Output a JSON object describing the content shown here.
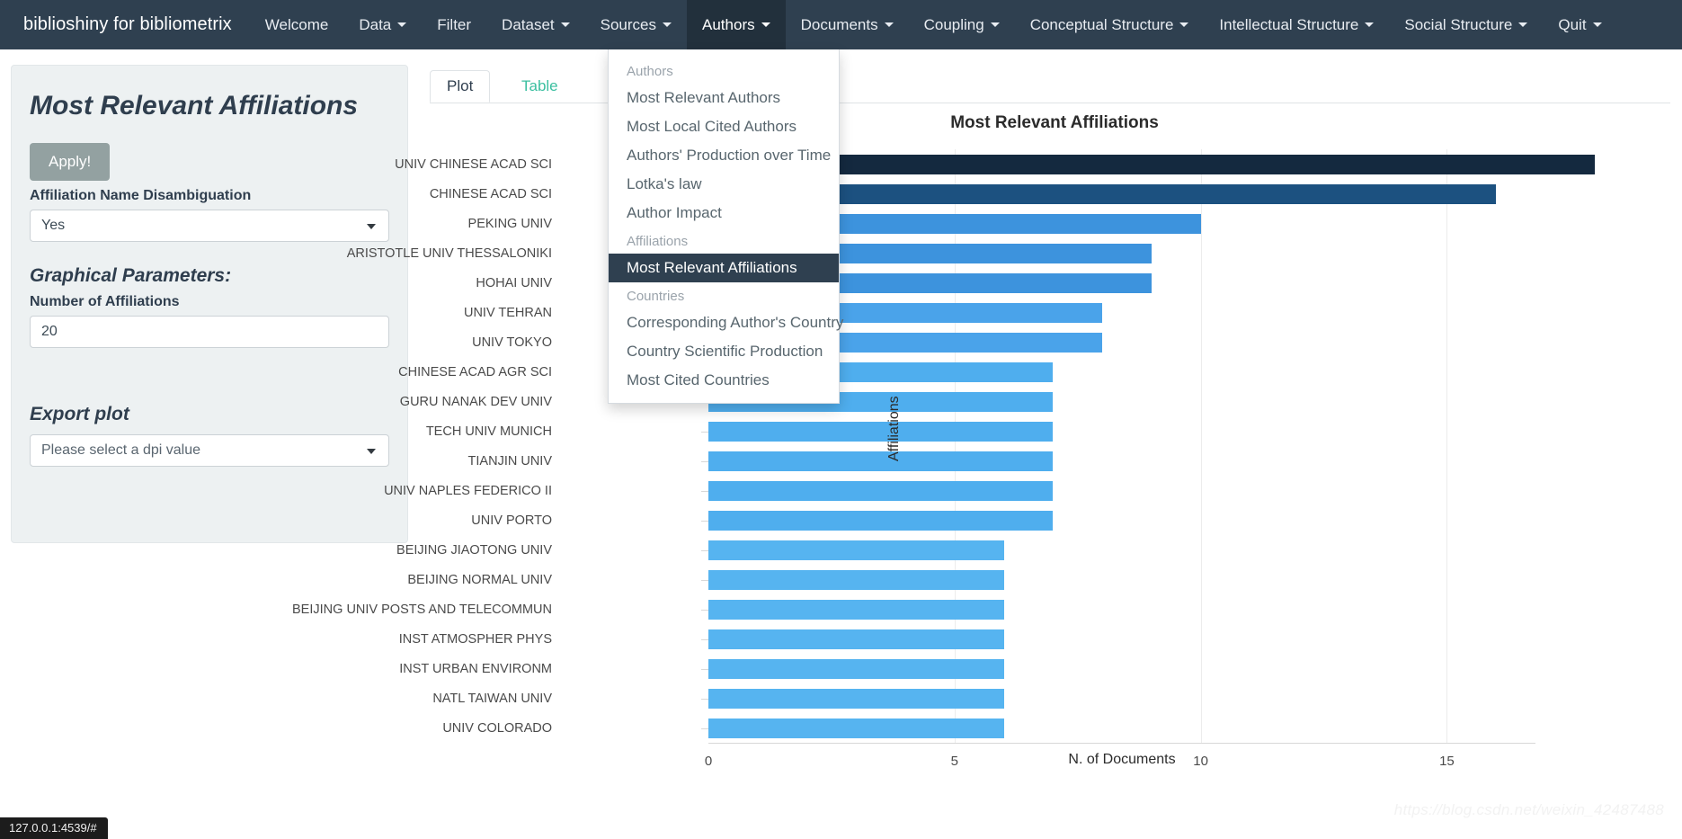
{
  "navbar": {
    "brand": "biblioshiny for bibliometrix",
    "items": [
      {
        "label": "Welcome",
        "caret": false
      },
      {
        "label": "Data",
        "caret": true
      },
      {
        "label": "Filter",
        "caret": false
      },
      {
        "label": "Dataset",
        "caret": true
      },
      {
        "label": "Sources",
        "caret": true
      },
      {
        "label": "Authors",
        "caret": true
      },
      {
        "label": "Documents",
        "caret": true
      },
      {
        "label": "Coupling",
        "caret": true
      },
      {
        "label": "Conceptual Structure",
        "caret": true
      },
      {
        "label": "Intellectual Structure",
        "caret": true
      },
      {
        "label": "Social Structure",
        "caret": true
      },
      {
        "label": "Quit",
        "caret": true
      }
    ],
    "open_item": "Authors"
  },
  "dropdown": {
    "groups": [
      {
        "header": "Authors",
        "items": [
          "Most Relevant Authors",
          "Most Local Cited Authors",
          "Authors' Production over Time",
          "Lotka's law",
          "Author Impact"
        ]
      },
      {
        "header": "Affiliations",
        "items": [
          "Most Relevant Affiliations"
        ]
      },
      {
        "header": "Countries",
        "items": [
          "Corresponding Author's Country",
          "Country Scientific Production",
          "Most Cited Countries"
        ]
      }
    ],
    "active_item": "Most Relevant Affiliations"
  },
  "sidebar": {
    "title": "Most Relevant Affiliations",
    "apply_label": "Apply!",
    "disambiguation_label": "Affiliation Name Disambiguation",
    "disambiguation_value": "Yes",
    "graphical_params_label": "Graphical Parameters:",
    "number_label": "Number of Affiliations",
    "number_value": "20",
    "export_label": "Export plot",
    "dpi_placeholder": "Please select a dpi value"
  },
  "tabs": {
    "plot": "Plot",
    "table": "Table",
    "active": "Plot"
  },
  "statusbar": {
    "url": "127.0.0.1:4539/#"
  },
  "watermark": {
    "text": "https://blog.csdn.net/weixin_42487488"
  },
  "chart_data": {
    "type": "bar",
    "orientation": "horizontal",
    "title": "Most Relevant Affiliations",
    "xlabel": "N. of Documents",
    "ylabel": "Affiliations",
    "xlim": [
      0,
      16.8
    ],
    "xticks": [
      0,
      5,
      10,
      15
    ],
    "grid": true,
    "legend": false,
    "categories": [
      "UNIV CHINESE ACAD SCI",
      "CHINESE ACAD SCI",
      "PEKING UNIV",
      "ARISTOTLE UNIV THESSALONIKI",
      "HOHAI UNIV",
      "UNIV TEHRAN",
      "UNIV TOKYO",
      "CHINESE ACAD AGR SCI",
      "GURU NANAK DEV UNIV",
      "TECH UNIV MUNICH",
      "TIANJIN UNIV",
      "UNIV NAPLES FEDERICO II",
      "UNIV PORTO",
      "BEIJING JIAOTONG UNIV",
      "BEIJING NORMAL UNIV",
      "BEIJING UNIV POSTS AND TELECOMMUN",
      "INST ATMOSPHER PHYS",
      "INST URBAN ENVIRONM",
      "NATL TAIWAN UNIV",
      "UNIV COLORADO"
    ],
    "values": [
      18,
      16,
      10,
      9,
      9,
      8,
      8,
      7,
      7,
      7,
      7,
      7,
      7,
      6,
      6,
      6,
      6,
      6,
      6,
      6
    ],
    "colors": [
      "#14293f",
      "#1c5180",
      "#3d93dd",
      "#3d93dd",
      "#3d93dd",
      "#4aa3ea",
      "#4aa3ea",
      "#4faeee",
      "#4faeee",
      "#4faeee",
      "#4faeee",
      "#4faeee",
      "#4faeee",
      "#56b4f0",
      "#56b4f0",
      "#56b4f0",
      "#56b4f0",
      "#56b4f0",
      "#56b4f0",
      "#56b4f0"
    ]
  }
}
